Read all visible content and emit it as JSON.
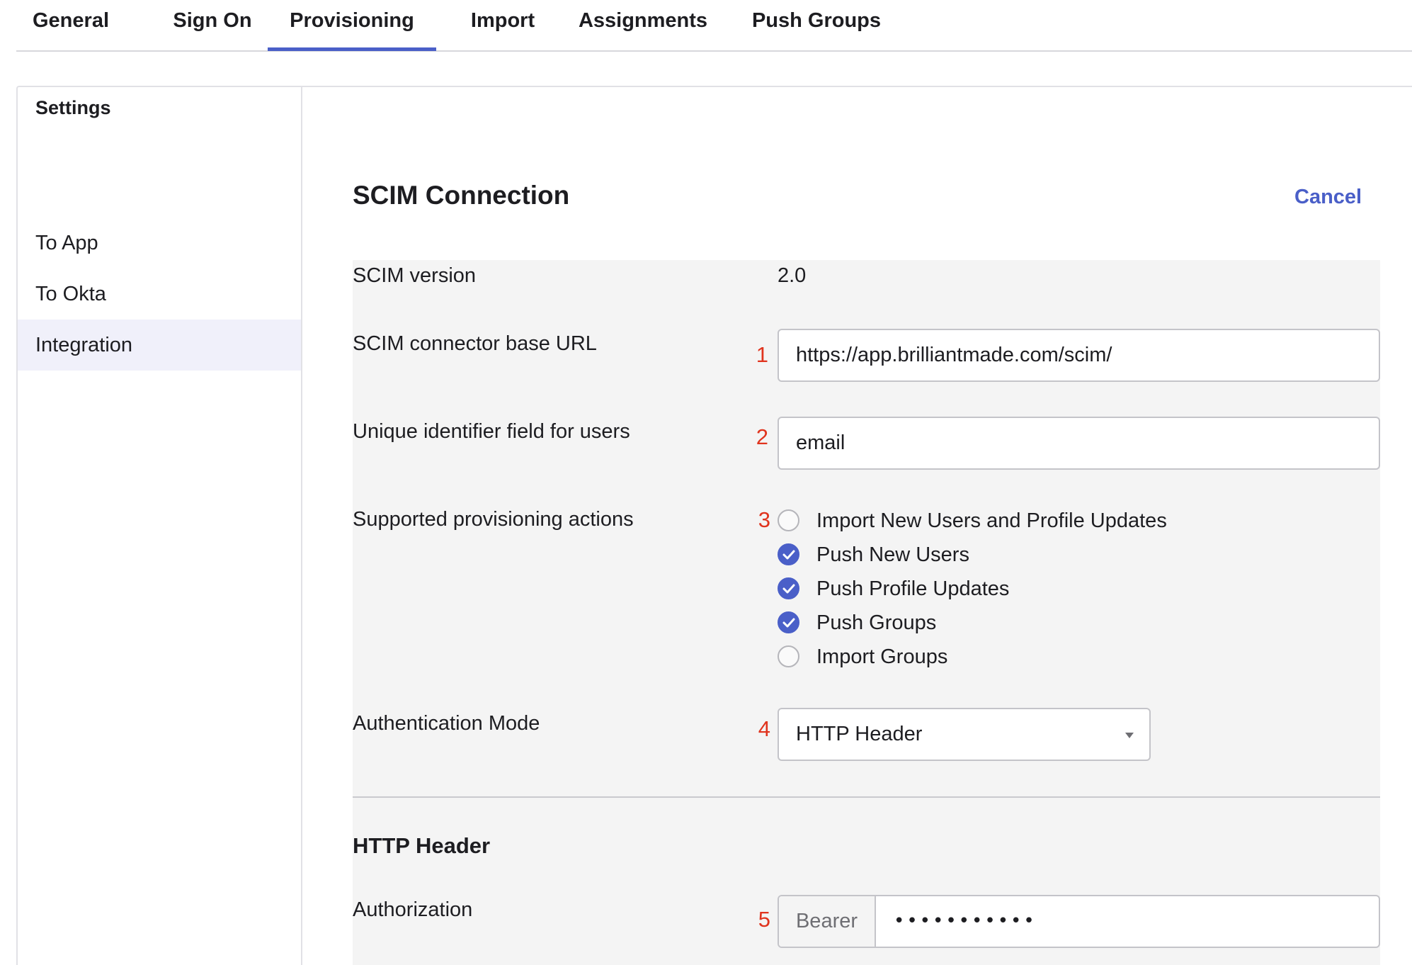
{
  "tabs": [
    {
      "label": "General"
    },
    {
      "label": "Sign On"
    },
    {
      "label": "Provisioning",
      "active": true
    },
    {
      "label": "Import"
    },
    {
      "label": "Assignments"
    },
    {
      "label": "Push Groups"
    }
  ],
  "sidebar": {
    "heading": "Settings",
    "items": [
      {
        "label": "To App"
      },
      {
        "label": "To Okta"
      },
      {
        "label": "Integration",
        "active": true
      }
    ]
  },
  "main": {
    "title": "SCIM Connection",
    "cancel_label": "Cancel"
  },
  "form": {
    "scim_version": {
      "label": "SCIM version",
      "value": "2.0"
    },
    "base_url": {
      "label": "SCIM connector base URL",
      "step": "1",
      "value": "https://app.brilliantmade.com/scim/"
    },
    "unique_id": {
      "label": "Unique identifier field for users",
      "step": "2",
      "value": "email"
    },
    "provisioning_actions": {
      "label": "Supported provisioning actions",
      "step": "3",
      "options": [
        {
          "label": "Import New Users and Profile Updates",
          "checked": false
        },
        {
          "label": "Push New Users",
          "checked": true
        },
        {
          "label": "Push Profile Updates",
          "checked": true
        },
        {
          "label": "Push Groups",
          "checked": true
        },
        {
          "label": "Import Groups",
          "checked": false
        }
      ]
    },
    "auth_mode": {
      "label": "Authentication Mode",
      "step": "4",
      "selected": "HTTP Header"
    }
  },
  "http_header": {
    "section_title": "HTTP Header",
    "authorization": {
      "label": "Authorization",
      "step": "5",
      "prefix": "Bearer",
      "masked_value": "•••••••••••"
    }
  },
  "colors": {
    "accent": "#4a5fc8",
    "step_number": "#e0341e",
    "form_background": "#f4f4f4"
  }
}
